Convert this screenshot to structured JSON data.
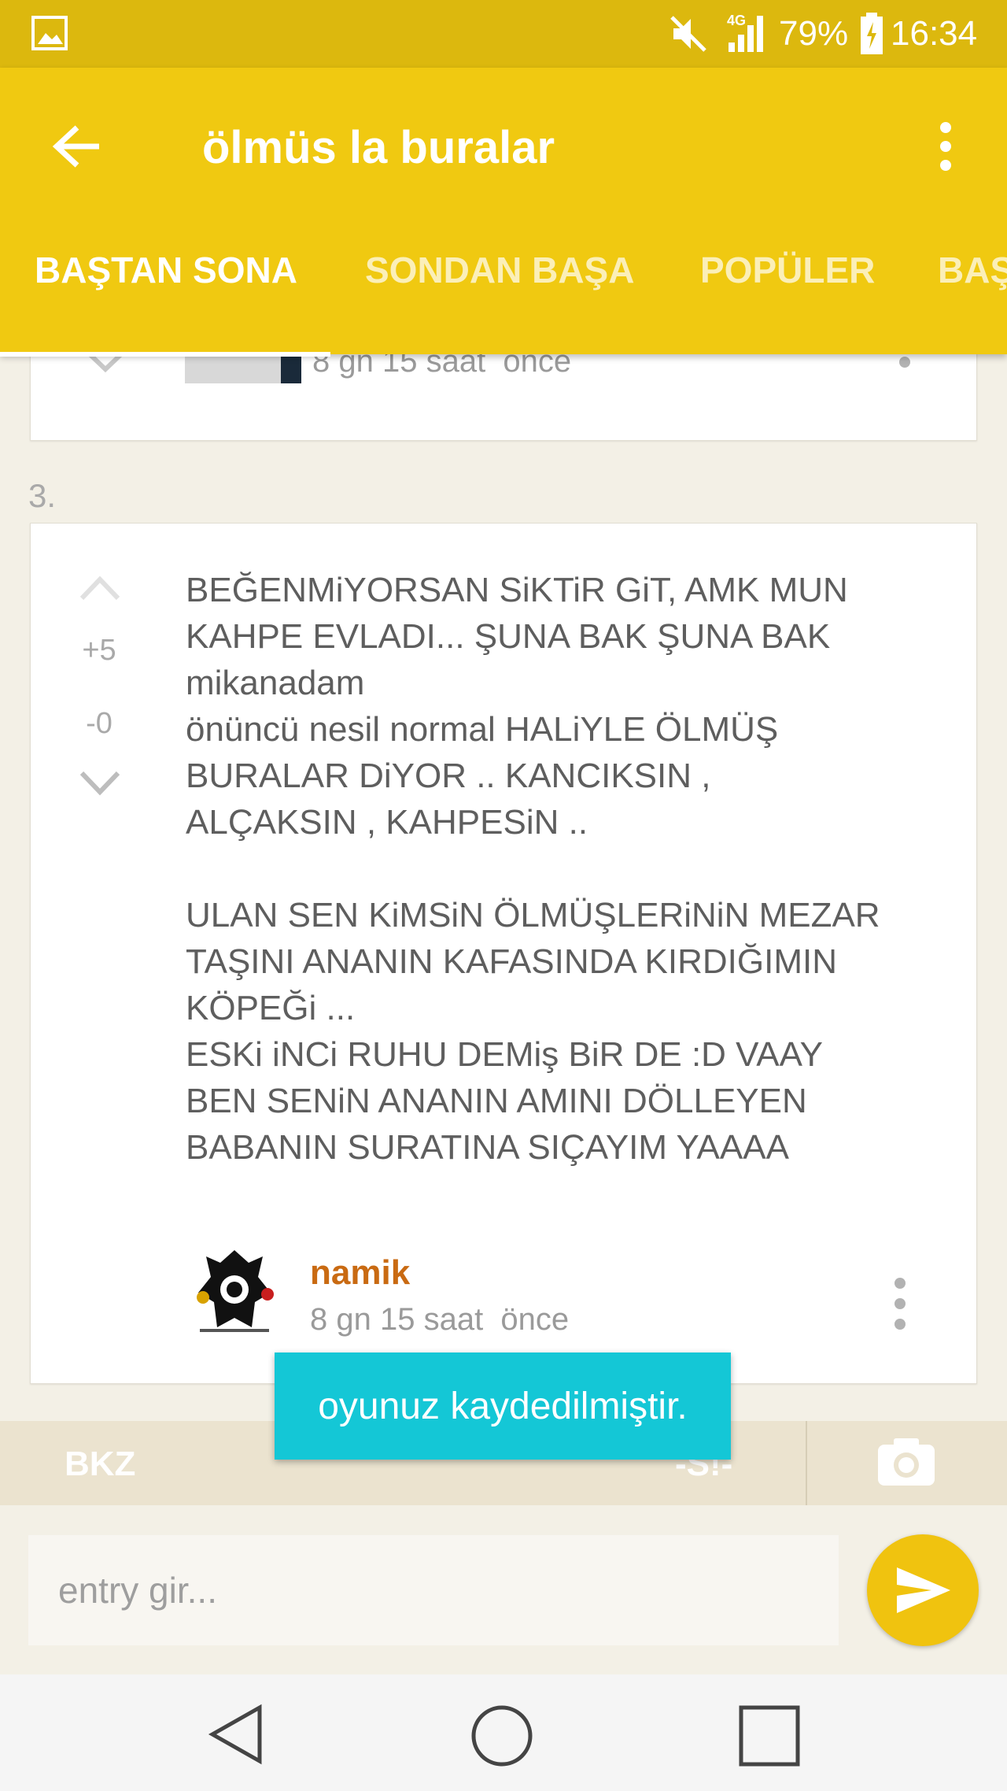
{
  "status_bar": {
    "battery": "79%",
    "time": "16:34",
    "network": "4G"
  },
  "app_bar": {
    "title": "ölmüs la buralar",
    "tabs": [
      "BAŞTAN SONA",
      "SONDAN BAŞA",
      "POPÜLER",
      "BAŞ"
    ],
    "active_tab": "BAŞTAN SONA"
  },
  "previous_entry": {
    "meta": "8 gn 15 saat  önce"
  },
  "entry": {
    "number": "3.",
    "upvotes": "+5",
    "downvotes": "-0",
    "text": "BEĞENMiYORSAN SiKTiR GiT, AMK MUN\nKAHPE EVLADI... ŞUNA BAK ŞUNA BAK\nmikanadam\nönüncü nesil normal HALiYLE ÖLMÜŞ\nBURALAR DiYOR .. KANCIKSIN ,\nALÇAKSIN , KAHPESiN ..\n\nULAN SEN KiMSiN ÖLMÜŞLERiNiN MEZAR\nTAŞINI ANANIN KAFASINDA KIRDIĞIMIN\nKÖPEĞi ...\nESKi iNCi RUHU DEMiş BiR DE :D VAAY\nBEN SENiN ANANIN AMINI DÖLLEYEN\nBABANIN SURATINA SIÇAYIM YAAAA",
    "author": "namik",
    "time": "8 gn 15 saat  önce"
  },
  "toolbar": {
    "bkz": "BKZ",
    "spoiler": "-S!-"
  },
  "input": {
    "placeholder": "entry gir..."
  },
  "toast": "oyunuz kaydedilmiştir.",
  "colors": {
    "app_bar": "#f0c911",
    "status_bar": "#dcb80e",
    "author": "#c96a12",
    "toast": "#14c7d6",
    "send": "#f0c30f"
  }
}
